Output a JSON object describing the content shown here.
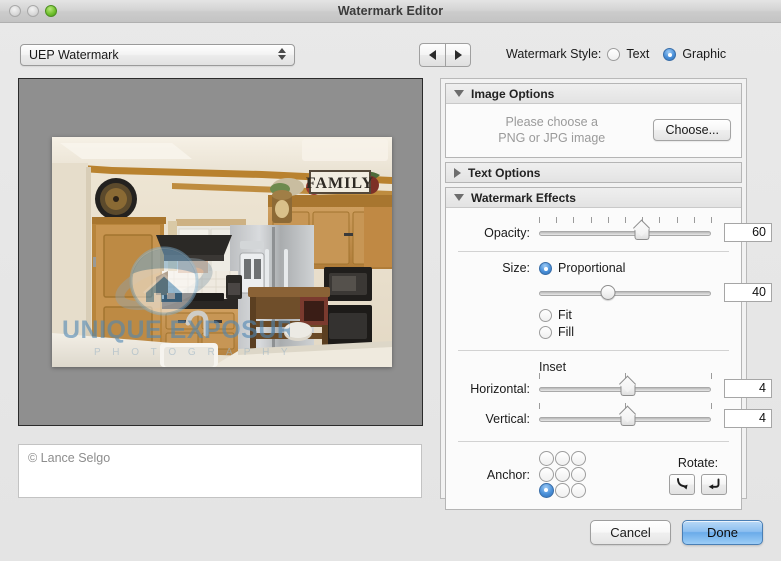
{
  "window": {
    "title": "Watermark Editor",
    "controls": {
      "close": "close-button",
      "minimize": "minimize-button",
      "zoom": "zoom-button"
    }
  },
  "toolbar": {
    "preset_value": "UEP Watermark",
    "prev_label": "◀",
    "next_label": "▶",
    "style_label": "Watermark Style:",
    "style_options": [
      "Text",
      "Graphic"
    ],
    "style_text_label": "Text",
    "style_graphic_label": "Graphic",
    "style_selected": "Graphic"
  },
  "preview": {
    "caption_value": "© Lance Selgo",
    "watermark": {
      "line1": "UNIQUE",
      "line2": "EXPOSURE",
      "line3": "P H O T O G R A P H Y",
      "color": "#5b8fb9",
      "opacity": 0.6
    }
  },
  "panel": {
    "image_options": {
      "title": "Image Options",
      "expanded": true,
      "message_line1": "Please choose a",
      "message_line2": "PNG or JPG image",
      "choose_label": "Choose..."
    },
    "text_options": {
      "title": "Text Options",
      "expanded": false
    },
    "watermark_effects": {
      "title": "Watermark Effects",
      "expanded": true,
      "opacity": {
        "label": "Opacity:",
        "value": "60",
        "percent": 60,
        "ticks": 11
      },
      "size": {
        "label": "Size:",
        "mode_proportional": "Proportional",
        "mode_fit": "Fit",
        "mode_fill": "Fill",
        "selected_mode": "Proportional",
        "value": "40",
        "percent": 40
      },
      "inset": {
        "title": "Inset",
        "horizontal_label": "Horizontal:",
        "horizontal_value": "4",
        "horizontal_percent": 52,
        "vertical_label": "Vertical:",
        "vertical_value": "4",
        "vertical_percent": 52,
        "ticks": 3
      },
      "anchor": {
        "label": "Anchor:",
        "selected_row": 2,
        "selected_col": 0
      },
      "rotate": {
        "label": "Rotate:",
        "ccw_glyph": "⤵",
        "cw_glyph": "↵"
      }
    }
  },
  "footer": {
    "cancel_label": "Cancel",
    "done_label": "Done"
  }
}
